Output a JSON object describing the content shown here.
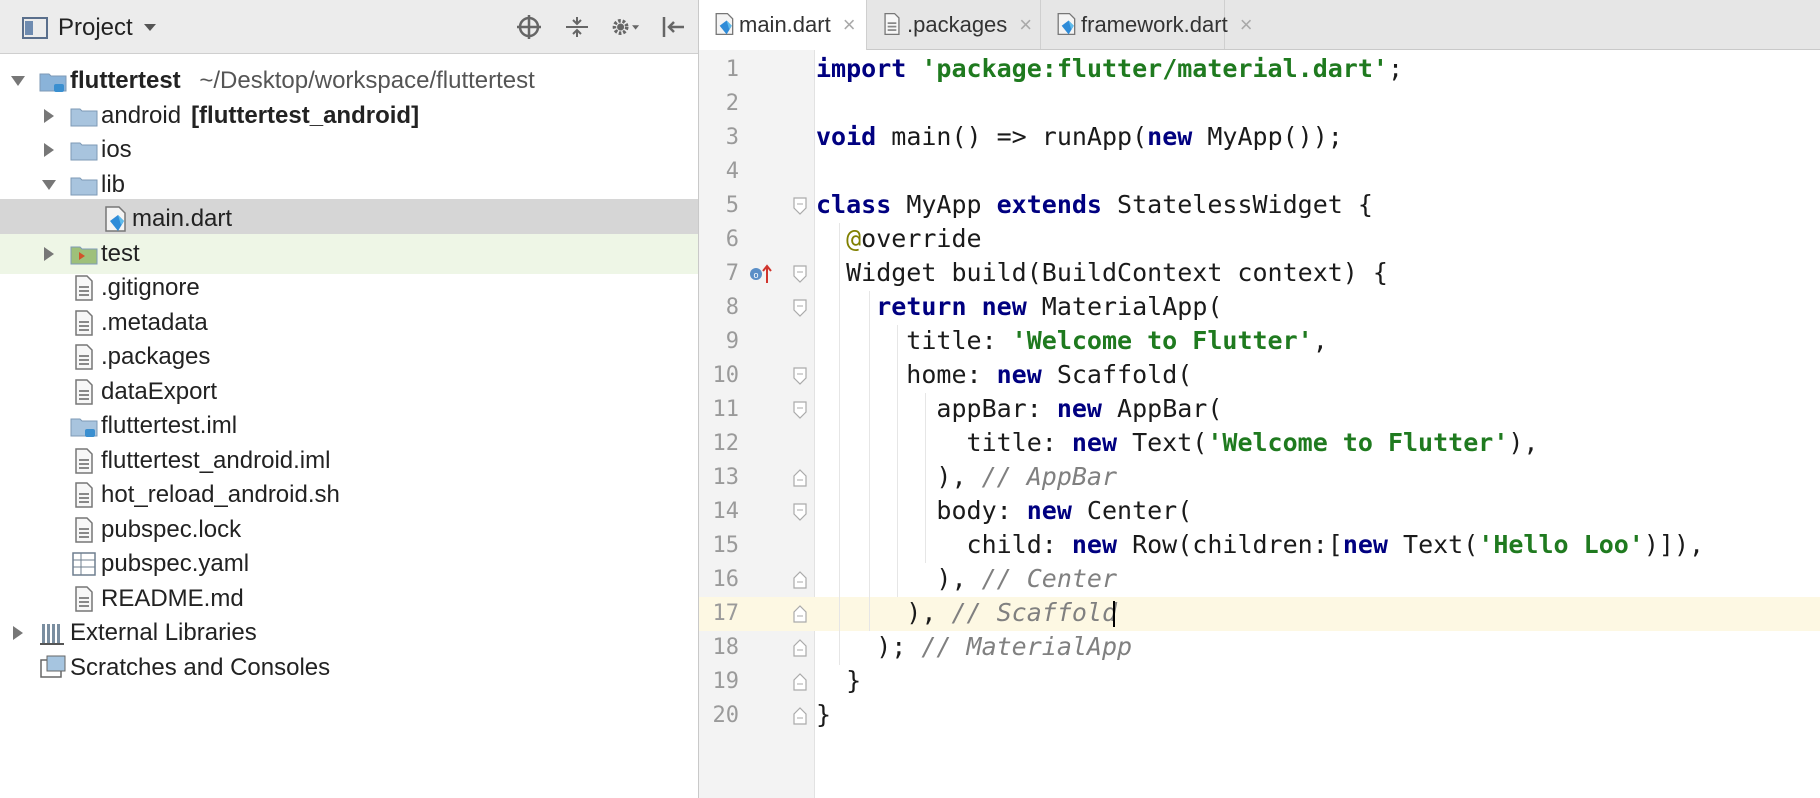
{
  "project_panel": {
    "title": "Project",
    "tree": [
      {
        "label": "fluttertest",
        "path": "~/Desktop/workspace/fluttertest",
        "bold": true,
        "expanded": true,
        "level": 0,
        "icon": "module-folder-icon"
      },
      {
        "label": "android",
        "suffix": "[fluttertest_android]",
        "bold_suffix": true,
        "expanded": false,
        "level": 1,
        "icon": "folder-icon"
      },
      {
        "label": "ios",
        "expanded": false,
        "level": 1,
        "icon": "folder-icon"
      },
      {
        "label": "lib",
        "expanded": true,
        "level": 1,
        "icon": "folder-icon"
      },
      {
        "label": "main.dart",
        "level": 2,
        "selected": true,
        "icon": "dart-file-icon"
      },
      {
        "label": "test",
        "expanded": false,
        "level": 1,
        "tested": true,
        "icon": "test-folder-icon"
      },
      {
        "label": ".gitignore",
        "level": 1,
        "icon": "file-icon"
      },
      {
        "label": ".metadata",
        "level": 1,
        "icon": "file-icon"
      },
      {
        "label": ".packages",
        "level": 1,
        "icon": "file-icon"
      },
      {
        "label": "dataExport",
        "level": 1,
        "icon": "file-icon"
      },
      {
        "label": "fluttertest.iml",
        "level": 1,
        "icon": "iml-file-icon"
      },
      {
        "label": "fluttertest_android.iml",
        "level": 1,
        "icon": "file-icon"
      },
      {
        "label": "hot_reload_android.sh",
        "level": 1,
        "icon": "file-icon"
      },
      {
        "label": "pubspec.lock",
        "level": 1,
        "icon": "file-icon"
      },
      {
        "label": "pubspec.yaml",
        "level": 1,
        "icon": "yaml-file-icon"
      },
      {
        "label": "README.md",
        "level": 1,
        "icon": "file-icon"
      },
      {
        "label": "External Libraries",
        "expanded": false,
        "level": 0,
        "icon": "libraries-icon"
      },
      {
        "label": "Scratches and Consoles",
        "level": 0,
        "icon": "scratches-icon"
      }
    ]
  },
  "tabs": [
    {
      "label": "main.dart",
      "active": true,
      "close": "×"
    },
    {
      "label": ".packages",
      "active": false,
      "close": "×"
    },
    {
      "label": "framework.dart",
      "active": false,
      "close": "×"
    }
  ],
  "code_lines": [
    {
      "n": "1",
      "tokens": [
        [
          "kw",
          "import"
        ],
        [
          "t",
          " "
        ],
        [
          "str",
          "'package:flutter/material.dart'"
        ],
        [
          "t",
          ";"
        ]
      ]
    },
    {
      "n": "2",
      "tokens": []
    },
    {
      "n": "3",
      "tokens": [
        [
          "kw",
          "void"
        ],
        [
          "t",
          " main() => runApp("
        ],
        [
          "kw",
          "new"
        ],
        [
          "t",
          " MyApp());"
        ]
      ]
    },
    {
      "n": "4",
      "tokens": []
    },
    {
      "n": "5",
      "tokens": [
        [
          "kw",
          "class"
        ],
        [
          "t",
          " MyApp "
        ],
        [
          "kw",
          "extends"
        ],
        [
          "t",
          " StatelessWidget {"
        ]
      ]
    },
    {
      "n": "6",
      "tokens": [
        [
          "t",
          "  "
        ],
        [
          "ann",
          "@"
        ],
        [
          "t",
          "override"
        ]
      ]
    },
    {
      "n": "7",
      "tokens": [
        [
          "t",
          "  Widget build(BuildContext context) {"
        ]
      ]
    },
    {
      "n": "8",
      "tokens": [
        [
          "t",
          "    "
        ],
        [
          "kw",
          "return"
        ],
        [
          "t",
          " "
        ],
        [
          "kw",
          "new"
        ],
        [
          "t",
          " MaterialApp("
        ]
      ]
    },
    {
      "n": "9",
      "tokens": [
        [
          "t",
          "      title: "
        ],
        [
          "str",
          "'Welcome to Flutter'"
        ],
        [
          "t",
          ","
        ]
      ]
    },
    {
      "n": "10",
      "tokens": [
        [
          "t",
          "      home: "
        ],
        [
          "kw",
          "new"
        ],
        [
          "t",
          " Scaffold("
        ]
      ]
    },
    {
      "n": "11",
      "tokens": [
        [
          "t",
          "        appBar: "
        ],
        [
          "kw",
          "new"
        ],
        [
          "t",
          " AppBar("
        ]
      ]
    },
    {
      "n": "12",
      "tokens": [
        [
          "t",
          "          title: "
        ],
        [
          "kw",
          "new"
        ],
        [
          "t",
          " Text("
        ],
        [
          "str",
          "'Welcome to Flutter'"
        ],
        [
          "t",
          "),"
        ]
      ]
    },
    {
      "n": "13",
      "tokens": [
        [
          "t",
          "        ), "
        ],
        [
          "cm",
          "// AppBar"
        ]
      ]
    },
    {
      "n": "14",
      "tokens": [
        [
          "t",
          "        body: "
        ],
        [
          "kw",
          "new"
        ],
        [
          "t",
          " Center("
        ]
      ]
    },
    {
      "n": "15",
      "tokens": [
        [
          "t",
          "          child: "
        ],
        [
          "kw",
          "new"
        ],
        [
          "t",
          " Row(children:["
        ],
        [
          "kw",
          "new"
        ],
        [
          "t",
          " Text("
        ],
        [
          "str",
          "'Hello Loo'"
        ],
        [
          "t",
          ")]),"
        ]
      ]
    },
    {
      "n": "16",
      "tokens": [
        [
          "t",
          "        ), "
        ],
        [
          "cm",
          "// Center"
        ]
      ]
    },
    {
      "n": "17",
      "tokens": [
        [
          "t",
          "      ), "
        ],
        [
          "cm",
          "// Scaffold"
        ]
      ],
      "current": true
    },
    {
      "n": "18",
      "tokens": [
        [
          "t",
          "    ); "
        ],
        [
          "cm",
          "// MaterialApp"
        ]
      ]
    },
    {
      "n": "19",
      "tokens": [
        [
          "t",
          "  }"
        ]
      ]
    },
    {
      "n": "20",
      "tokens": [
        [
          "t",
          "}"
        ]
      ]
    }
  ]
}
